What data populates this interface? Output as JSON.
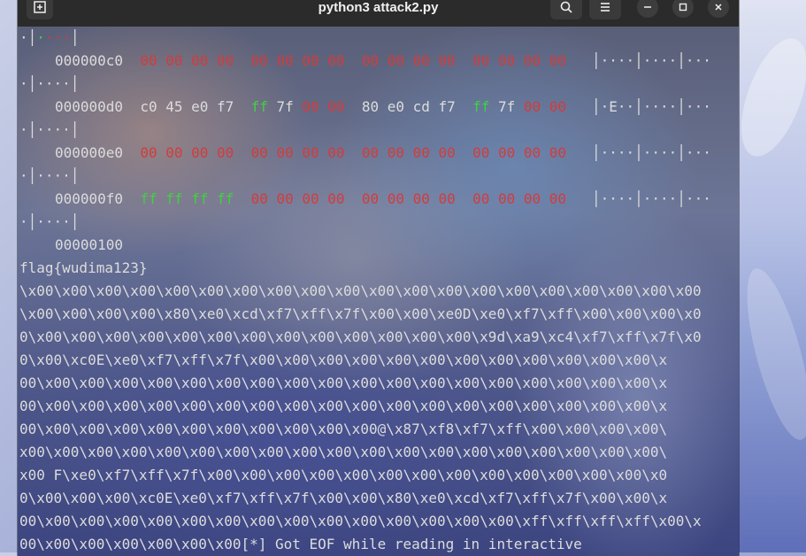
{
  "window": {
    "title": "python3 attack2.py"
  },
  "icons": {
    "new_tab": "new-tab-icon",
    "search": "search-icon",
    "menu": "hamburger-menu-icon",
    "minimize": "minimize-icon",
    "maximize": "maximize-icon",
    "close": "close-icon"
  },
  "colors": {
    "zero_byte": "#d23c3c",
    "ff_byte": "#3fd23f",
    "text": "#dcdcdc",
    "titlebar": "#2b2b2b"
  },
  "terminal": {
    "hexdump": {
      "row0_tail_prefix": "·",
      "row0_tail_sep": "│",
      "row0_tail_dots_a": "·",
      "row0_tail_dots_b": "···",
      "row0_tail_end": "│",
      "rows": [
        {
          "addr": "000000c0",
          "bytes": [
            "00",
            "00",
            "00",
            "00",
            "00",
            "00",
            "00",
            "00",
            "00",
            "00",
            "00",
            "00",
            "00",
            "00",
            "00",
            "00"
          ],
          "ascii": "│····│····│···",
          "wrap": "·│····│"
        },
        {
          "addr": "000000d0",
          "bytes": [
            "c0",
            "45",
            "e0",
            "f7",
            "ff",
            "7f",
            "00",
            "00",
            "80",
            "e0",
            "cd",
            "f7",
            "ff",
            "7f",
            "00",
            "00"
          ],
          "ascii": "│·E··│····│···",
          "wrap": "·│····│"
        },
        {
          "addr": "000000e0",
          "bytes": [
            "00",
            "00",
            "00",
            "00",
            "00",
            "00",
            "00",
            "00",
            "00",
            "00",
            "00",
            "00",
            "00",
            "00",
            "00",
            "00"
          ],
          "ascii": "│····│····│···",
          "wrap": "·│····│"
        },
        {
          "addr": "000000f0",
          "bytes": [
            "ff",
            "ff",
            "ff",
            "ff",
            "00",
            "00",
            "00",
            "00",
            "00",
            "00",
            "00",
            "00",
            "00",
            "00",
            "00",
            "00"
          ],
          "ascii": "│····│····│···",
          "wrap": "·│····│"
        }
      ],
      "end_addr": "00000100"
    },
    "flag": "flag{wudima123}",
    "raw_lines": [
      "\\x00\\x00\\x00\\x00\\x00\\x00\\x00\\x00\\x00\\x00\\x00\\x00\\x00\\x00\\x00\\x00\\x00\\x00\\x00\\x00",
      "\\x00\\x00\\x00\\x00\\x80\\xe0\\xcd\\xf7\\xff\\x7f\\x00\\x00\\xe0D\\xe0\\xf7\\xff\\x00\\x00\\x00\\x0",
      "0\\x00\\x00\\x00\\x00\\x00\\x00\\x00\\x00\\x00\\x00\\x00\\x00\\x00\\x9d\\xa9\\xc4\\xf7\\xff\\x7f\\x0",
      "0\\x00\\xc0E\\xe0\\xf7\\xff\\x7f\\x00\\x00\\x00\\x00\\x00\\x00\\x00\\x00\\x00\\x00\\x00\\x00\\x",
      "00\\x00\\x00\\x00\\x00\\x00\\x00\\x00\\x00\\x00\\x00\\x00\\x00\\x00\\x00\\x00\\x00\\x00\\x00\\x",
      "00\\x00\\x00\\x00\\x00\\x00\\x00\\x00\\x00\\x00\\x00\\x00\\x00\\x00\\x00\\x00\\x00\\x00\\x00\\x",
      "00\\x00\\x00\\x00\\x00\\x00\\x00\\x00\\x00\\x00\\x00@\\x87\\xf8\\xf7\\xff\\x00\\x00\\x00\\x00\\",
      "x00\\x00\\x00\\x00\\x00\\x00\\x00\\x00\\x00\\x00\\x00\\x00\\x00\\x00\\x00\\x00\\x00\\x00\\x00\\",
      "x00 F\\xe0\\xf7\\xff\\x7f\\x00\\x00\\x00\\x00\\x00\\x00\\x00\\x00\\x00\\x00\\x00\\x00\\x00\\x0",
      "0\\x00\\x00\\x00\\xc0E\\xe0\\xf7\\xff\\x7f\\x00\\x00\\x80\\xe0\\xcd\\xf7\\xff\\x7f\\x00\\x00\\x",
      "00\\x00\\x00\\x00\\x00\\x00\\x00\\x00\\x00\\x00\\x00\\x00\\x00\\x00\\x00\\xff\\xff\\xff\\xff\\x00\\x",
      "00\\x00\\x00\\x00\\x00\\x00\\x00[*] Got EOF while reading in interactive"
    ]
  }
}
